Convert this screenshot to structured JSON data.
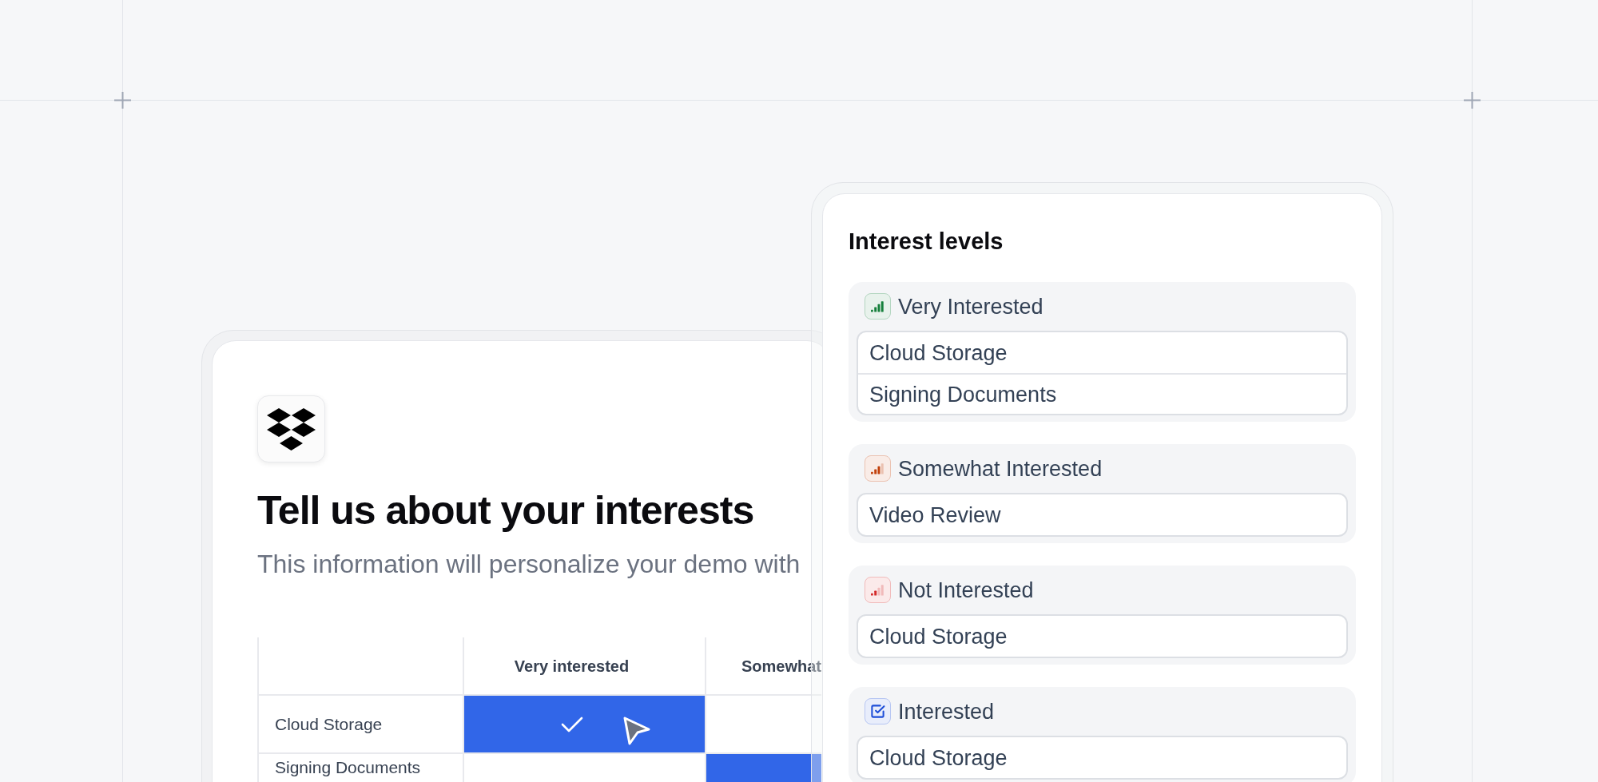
{
  "intro_card": {
    "title": "Tell us about your interests",
    "subtitle": "This information will personalize your demo with"
  },
  "matrix": {
    "columns": [
      "Very interested",
      "Somewhat"
    ],
    "rows": [
      {
        "label": "Cloud Storage",
        "cells": [
          {
            "selected": true,
            "checked": true
          },
          {
            "selected": false,
            "checked": false
          }
        ]
      },
      {
        "label": "Signing Documents",
        "cells": [
          {
            "selected": false,
            "checked": false
          },
          {
            "selected": true,
            "checked": false
          }
        ]
      }
    ]
  },
  "interest_levels": {
    "title": "Interest levels",
    "groups": [
      {
        "label": "Very Interested",
        "kind": "high",
        "color": "#16803c",
        "items": [
          "Cloud Storage",
          "Signing Documents"
        ]
      },
      {
        "label": "Somewhat Interested",
        "kind": "medium",
        "color": "#c2410c",
        "items": [
          "Video Review"
        ]
      },
      {
        "label": "Not Interested",
        "kind": "low",
        "color": "#d42a2a",
        "items": [
          "Cloud Storage"
        ]
      },
      {
        "label": "Interested",
        "kind": "check",
        "color": "#1d4ed8",
        "items": [
          "Cloud Storage"
        ]
      }
    ]
  }
}
